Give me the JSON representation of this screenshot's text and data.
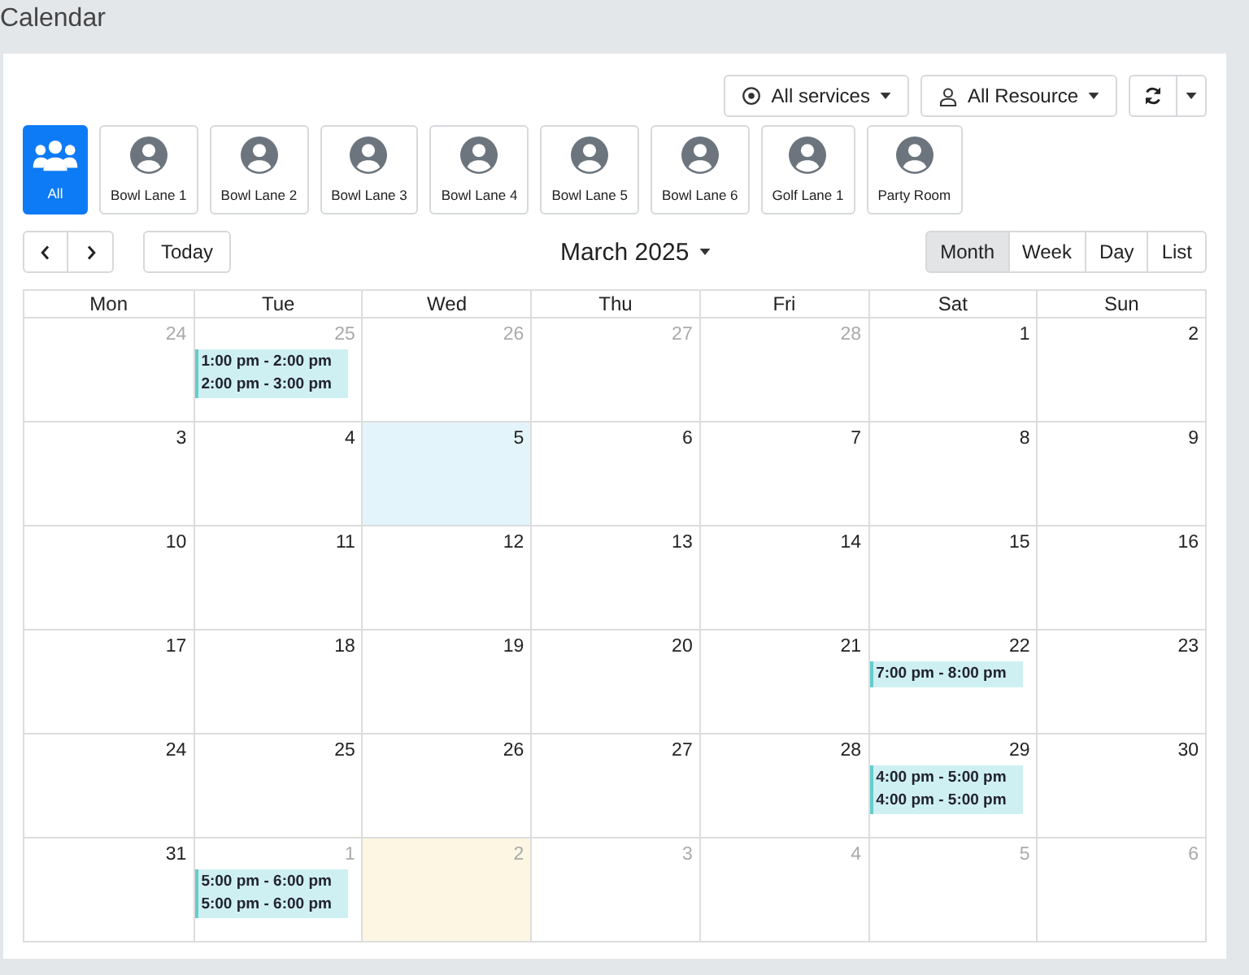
{
  "page_title": "Calendar",
  "filters": {
    "services": "All services",
    "resources": "All Resource"
  },
  "resources": [
    {
      "label": "All",
      "kind": "group",
      "selected": true
    },
    {
      "label": "Bowl Lane 1",
      "kind": "person",
      "selected": false
    },
    {
      "label": "Bowl Lane 2",
      "kind": "person",
      "selected": false
    },
    {
      "label": "Bowl Lane 3",
      "kind": "person",
      "selected": false
    },
    {
      "label": "Bowl Lane 4",
      "kind": "person",
      "selected": false
    },
    {
      "label": "Bowl Lane 5",
      "kind": "person",
      "selected": false
    },
    {
      "label": "Bowl Lane 6",
      "kind": "person",
      "selected": false
    },
    {
      "label": "Golf Lane 1",
      "kind": "person",
      "selected": false
    },
    {
      "label": "Party Room",
      "kind": "person",
      "selected": false
    }
  ],
  "toolbar": {
    "today": "Today",
    "title": "March 2025",
    "views": [
      {
        "label": "Month",
        "selected": true
      },
      {
        "label": "Week",
        "selected": false
      },
      {
        "label": "Day",
        "selected": false
      },
      {
        "label": "List",
        "selected": false
      }
    ]
  },
  "weekdays": [
    "Mon",
    "Tue",
    "Wed",
    "Thu",
    "Fri",
    "Sat",
    "Sun"
  ],
  "weeks": [
    [
      {
        "day": "24",
        "other_month": true
      },
      {
        "day": "25",
        "other_month": true,
        "events": [
          "1:00 pm - 2:00 pm",
          "2:00 pm - 3:00 pm"
        ]
      },
      {
        "day": "26",
        "other_month": true
      },
      {
        "day": "27",
        "other_month": true
      },
      {
        "day": "28",
        "other_month": true
      },
      {
        "day": "1",
        "other_month": false
      },
      {
        "day": "2",
        "other_month": false
      }
    ],
    [
      {
        "day": "3",
        "other_month": false
      },
      {
        "day": "4",
        "other_month": false
      },
      {
        "day": "5",
        "other_month": false,
        "color": "#e3f4fb"
      },
      {
        "day": "6",
        "other_month": false
      },
      {
        "day": "7",
        "other_month": false
      },
      {
        "day": "8",
        "other_month": false
      },
      {
        "day": "9",
        "other_month": false
      }
    ],
    [
      {
        "day": "10",
        "other_month": false
      },
      {
        "day": "11",
        "other_month": false
      },
      {
        "day": "12",
        "other_month": false
      },
      {
        "day": "13",
        "other_month": false
      },
      {
        "day": "14",
        "other_month": false
      },
      {
        "day": "15",
        "other_month": false
      },
      {
        "day": "16",
        "other_month": false
      }
    ],
    [
      {
        "day": "17",
        "other_month": false
      },
      {
        "day": "18",
        "other_month": false
      },
      {
        "day": "19",
        "other_month": false
      },
      {
        "day": "20",
        "other_month": false
      },
      {
        "day": "21",
        "other_month": false
      },
      {
        "day": "22",
        "other_month": false,
        "events": [
          "7:00 pm - 8:00 pm"
        ]
      },
      {
        "day": "23",
        "other_month": false
      }
    ],
    [
      {
        "day": "24",
        "other_month": false
      },
      {
        "day": "25",
        "other_month": false
      },
      {
        "day": "26",
        "other_month": false
      },
      {
        "day": "27",
        "other_month": false
      },
      {
        "day": "28",
        "other_month": false
      },
      {
        "day": "29",
        "other_month": false,
        "events": [
          "4:00 pm - 5:00 pm",
          "4:00 pm - 5:00 pm"
        ]
      },
      {
        "day": "30",
        "other_month": false
      }
    ],
    [
      {
        "day": "31",
        "other_month": false
      },
      {
        "day": "1",
        "other_month": true,
        "events": [
          "5:00 pm - 6:00 pm",
          "5:00 pm - 6:00 pm"
        ]
      },
      {
        "day": "2",
        "other_month": true,
        "color": "#fcf6e3"
      },
      {
        "day": "3",
        "other_month": true
      },
      {
        "day": "4",
        "other_month": true
      },
      {
        "day": "5",
        "other_month": true
      },
      {
        "day": "6",
        "other_month": true
      }
    ]
  ]
}
